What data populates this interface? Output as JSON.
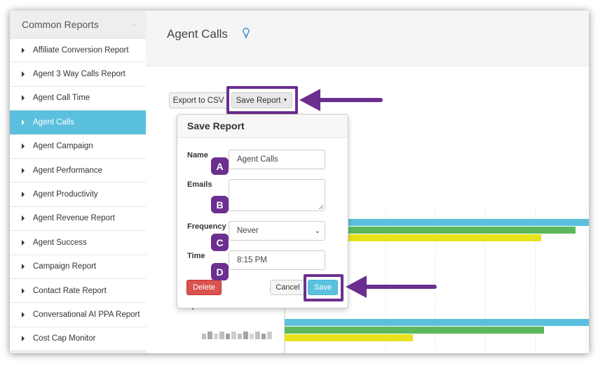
{
  "sidebar": {
    "header": "Common Reports",
    "header_icon": "chevron-down-icon",
    "items": [
      {
        "label": "Affiliate Conversion Report",
        "active": false
      },
      {
        "label": "Agent 3 Way Calls Report",
        "active": false
      },
      {
        "label": "Agent Call Time",
        "active": false
      },
      {
        "label": "Agent Calls",
        "active": true
      },
      {
        "label": "Agent Campaign",
        "active": false
      },
      {
        "label": "Agent Performance",
        "active": false
      },
      {
        "label": "Agent Productivity",
        "active": false
      },
      {
        "label": "Agent Revenue Report",
        "active": false
      },
      {
        "label": "Agent Success",
        "active": false
      },
      {
        "label": "Campaign Report",
        "active": false
      },
      {
        "label": "Contact Rate Report",
        "active": false
      },
      {
        "label": "Conversational AI PPA Report",
        "active": false
      },
      {
        "label": "Cost Cap Monitor",
        "active": false
      }
    ]
  },
  "header": {
    "title": "Agent Calls",
    "icon": "lightbulb-icon"
  },
  "toolbar": {
    "export_label": "Export to CSV",
    "save_report_label": "Save Report"
  },
  "save_report_popover": {
    "title": "Save Report",
    "name_label": "Name",
    "name_value": "Agent Calls",
    "emails_label": "Emails",
    "emails_value": "",
    "frequency_label": "Frequency",
    "frequency_value": "Never",
    "time_label": "Time",
    "time_value": "8:15 PM",
    "delete_label": "Delete",
    "cancel_label": "Cancel",
    "save_label": "Save"
  },
  "annotations": {
    "badges": [
      "A",
      "B",
      "C",
      "D"
    ],
    "accent_color": "#6b2f8f"
  },
  "colors": {
    "sidebar_active": "#5bc0de",
    "save_button": "#5bc0de",
    "delete_button": "#d9534f",
    "bar_blue": "#5bc0de",
    "bar_green": "#5cb85c",
    "bar_yellow": "#e8e21a"
  }
}
